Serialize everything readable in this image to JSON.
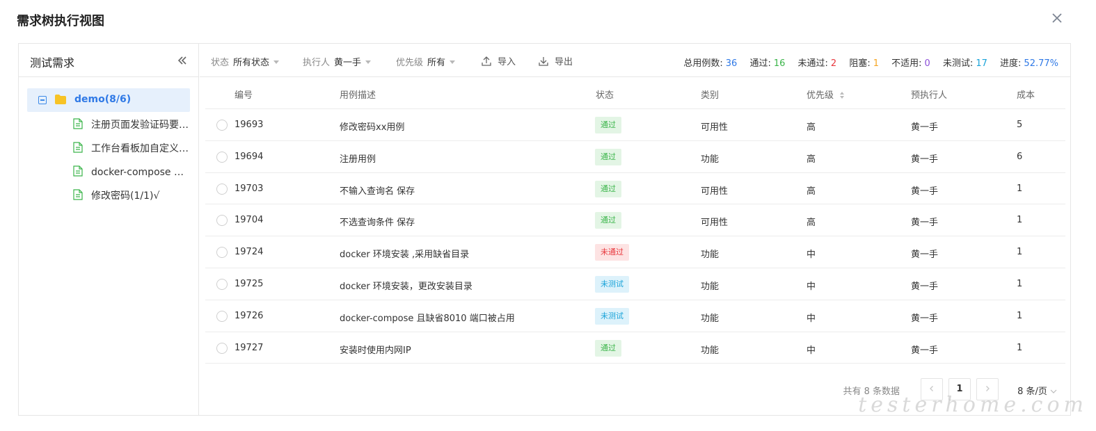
{
  "dialog": {
    "title": "需求树执行视图"
  },
  "tree": {
    "header": "测试需求",
    "root": "demo(8/6)",
    "children": [
      "注册页面发验证码要…",
      "工作台看板加自定义(…",
      "docker-compose 安…",
      "修改密码(1/1)√"
    ]
  },
  "toolbar": {
    "status_label": "状态",
    "status_value": "所有状态",
    "executor_label": "执行人",
    "executor_value": "黄一手",
    "priority_label": "优先级",
    "priority_value": "所有",
    "import_label": "导入",
    "export_label": "导出"
  },
  "stats": {
    "total_label": "总用例数:",
    "total": "36",
    "pass_label": "通过:",
    "pass": "16",
    "fail_label": "未通过:",
    "fail": "2",
    "blocked_label": "阻塞:",
    "blocked": "1",
    "na_label": "不适用:",
    "na": "0",
    "untested_label": "未测试:",
    "untested": "17",
    "progress_label": "进度:",
    "progress": "52.77%"
  },
  "colors": {
    "accent": "#2f79e6",
    "pass": "#3bb54a",
    "fail": "#e8383d",
    "blocked": "#f5a623",
    "na": "#8c4fd8",
    "untested": "#1aa3d9"
  },
  "table": {
    "headers": [
      "编号",
      "用例描述",
      "状态",
      "类别",
      "优先级",
      "预执行人",
      "成本"
    ],
    "rows": [
      {
        "id": "19693",
        "desc": "修改密码xx用例",
        "status": "通过",
        "status_type": "pass",
        "category": "可用性",
        "priority": "高",
        "executor": "黄一手",
        "cost": "5"
      },
      {
        "id": "19694",
        "desc": "注册用例",
        "status": "通过",
        "status_type": "pass",
        "category": "功能",
        "priority": "高",
        "executor": "黄一手",
        "cost": "6"
      },
      {
        "id": "19703",
        "desc": "不输入查询名 保存",
        "status": "通过",
        "status_type": "pass",
        "category": "可用性",
        "priority": "高",
        "executor": "黄一手",
        "cost": "1"
      },
      {
        "id": "19704",
        "desc": "不选查询条件 保存",
        "status": "通过",
        "status_type": "pass",
        "category": "可用性",
        "priority": "高",
        "executor": "黄一手",
        "cost": "1"
      },
      {
        "id": "19724",
        "desc": "docker 环境安装 ,采用缺省目录",
        "status": "未通过",
        "status_type": "fail",
        "category": "功能",
        "priority": "中",
        "executor": "黄一手",
        "cost": "1"
      },
      {
        "id": "19725",
        "desc": "docker 环境安装，更改安装目录",
        "status": "未测试",
        "status_type": "untested",
        "category": "功能",
        "priority": "中",
        "executor": "黄一手",
        "cost": "1"
      },
      {
        "id": "19726",
        "desc": "docker-compose 且缺省8010 端口被占用",
        "status": "未测试",
        "status_type": "untested",
        "category": "功能",
        "priority": "中",
        "executor": "黄一手",
        "cost": "1"
      },
      {
        "id": "19727",
        "desc": "安装时使用内网IP",
        "status": "通过",
        "status_type": "pass",
        "category": "功能",
        "priority": "中",
        "executor": "黄一手",
        "cost": "1"
      }
    ]
  },
  "pagination": {
    "total_text": "共有 8 条数据",
    "current_page": "1",
    "page_size": "8 条/页",
    "prev_icon": "chevron-left-icon",
    "next_icon": "chevron-right-icon"
  },
  "watermark": "testerhome.com"
}
